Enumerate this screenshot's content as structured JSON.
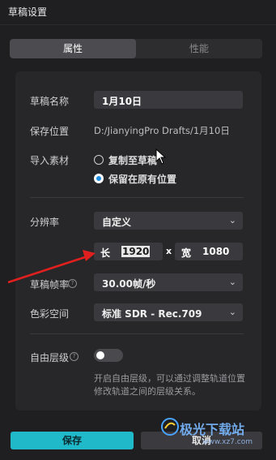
{
  "window": {
    "title": "草稿设置"
  },
  "tabs": [
    {
      "label": "属性",
      "active": true
    },
    {
      "label": "性能",
      "active": false
    }
  ],
  "fields": {
    "draft_name_label": "草稿名称",
    "draft_name_value": "1月10日",
    "save_location_label": "保存位置",
    "save_location_value": "D:/JianyingPro Drafts/1月10日",
    "import_label": "导入素材",
    "import_options": [
      {
        "label": "复制至草稿",
        "selected": false
      },
      {
        "label": "保留在原有位置",
        "selected": true
      }
    ],
    "resolution_label": "分辨率",
    "resolution_value": "自定义",
    "width_label": "长",
    "width_value": "1920",
    "times": "x",
    "height_label": "宽",
    "height_value": "1080",
    "framerate_label": "草稿帧率",
    "framerate_value": "30.00帧/秒",
    "colorspace_label": "色彩空间",
    "colorspace_value": "标准 SDR - Rec.709",
    "free_layer_label": "自由层级",
    "free_layer_enabled": false,
    "free_layer_desc": "开启自由层级，可以通过调整轨道位置修改轨道之间的层级关系。"
  },
  "buttons": {
    "save": "保存",
    "cancel": "取消"
  },
  "watermark": {
    "text": "极光下载站",
    "sub": "www.xz7.com"
  },
  "colors": {
    "accent": "#1fb9c9",
    "annotation_arrow": "#e0201e",
    "radio_selected": "#1f8de0"
  },
  "icons": {
    "help": "help-circle-icon",
    "dropdown": "chevron-down-icon"
  }
}
